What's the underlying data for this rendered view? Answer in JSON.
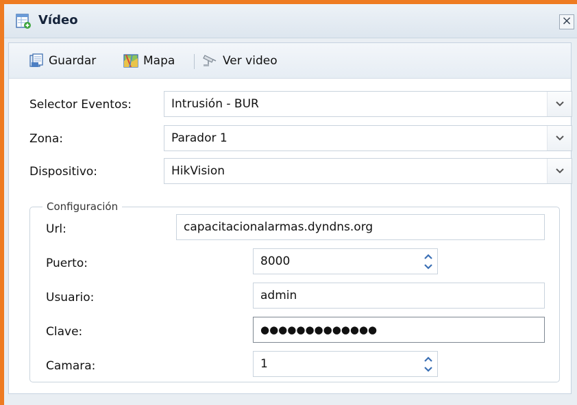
{
  "window": {
    "title": "Vídeo",
    "close_glyph": "×"
  },
  "toolbar": {
    "save_label": "Guardar",
    "map_label": "Mapa",
    "video_label": "Ver video"
  },
  "form": {
    "event_selector": {
      "label": "Selector Eventos:",
      "value": "Intrusión - BUR"
    },
    "zone": {
      "label": "Zona:",
      "value": "Parador 1"
    },
    "device": {
      "label": "Dispositivo:",
      "value": "HikVision"
    }
  },
  "config": {
    "legend": "Configuración",
    "url": {
      "label": "Url:",
      "value": "capacitacionalarmas.dyndns.org"
    },
    "port": {
      "label": "Puerto:",
      "value": "8000"
    },
    "user": {
      "label": "Usuario:",
      "value": "admin"
    },
    "password": {
      "label": "Clave:",
      "value": "●●●●●●●●●●●●●"
    },
    "camera": {
      "label": "Camara:",
      "value": "1"
    }
  },
  "colors": {
    "accent_border": "#ee7b22",
    "panel_bg": "#e9eef3"
  },
  "icons": [
    "window-grid-icon",
    "save-icon",
    "map-icon",
    "video-camera-icon",
    "chevron-down-icon",
    "spinner-up-icon",
    "spinner-down-icon",
    "close-icon"
  ]
}
